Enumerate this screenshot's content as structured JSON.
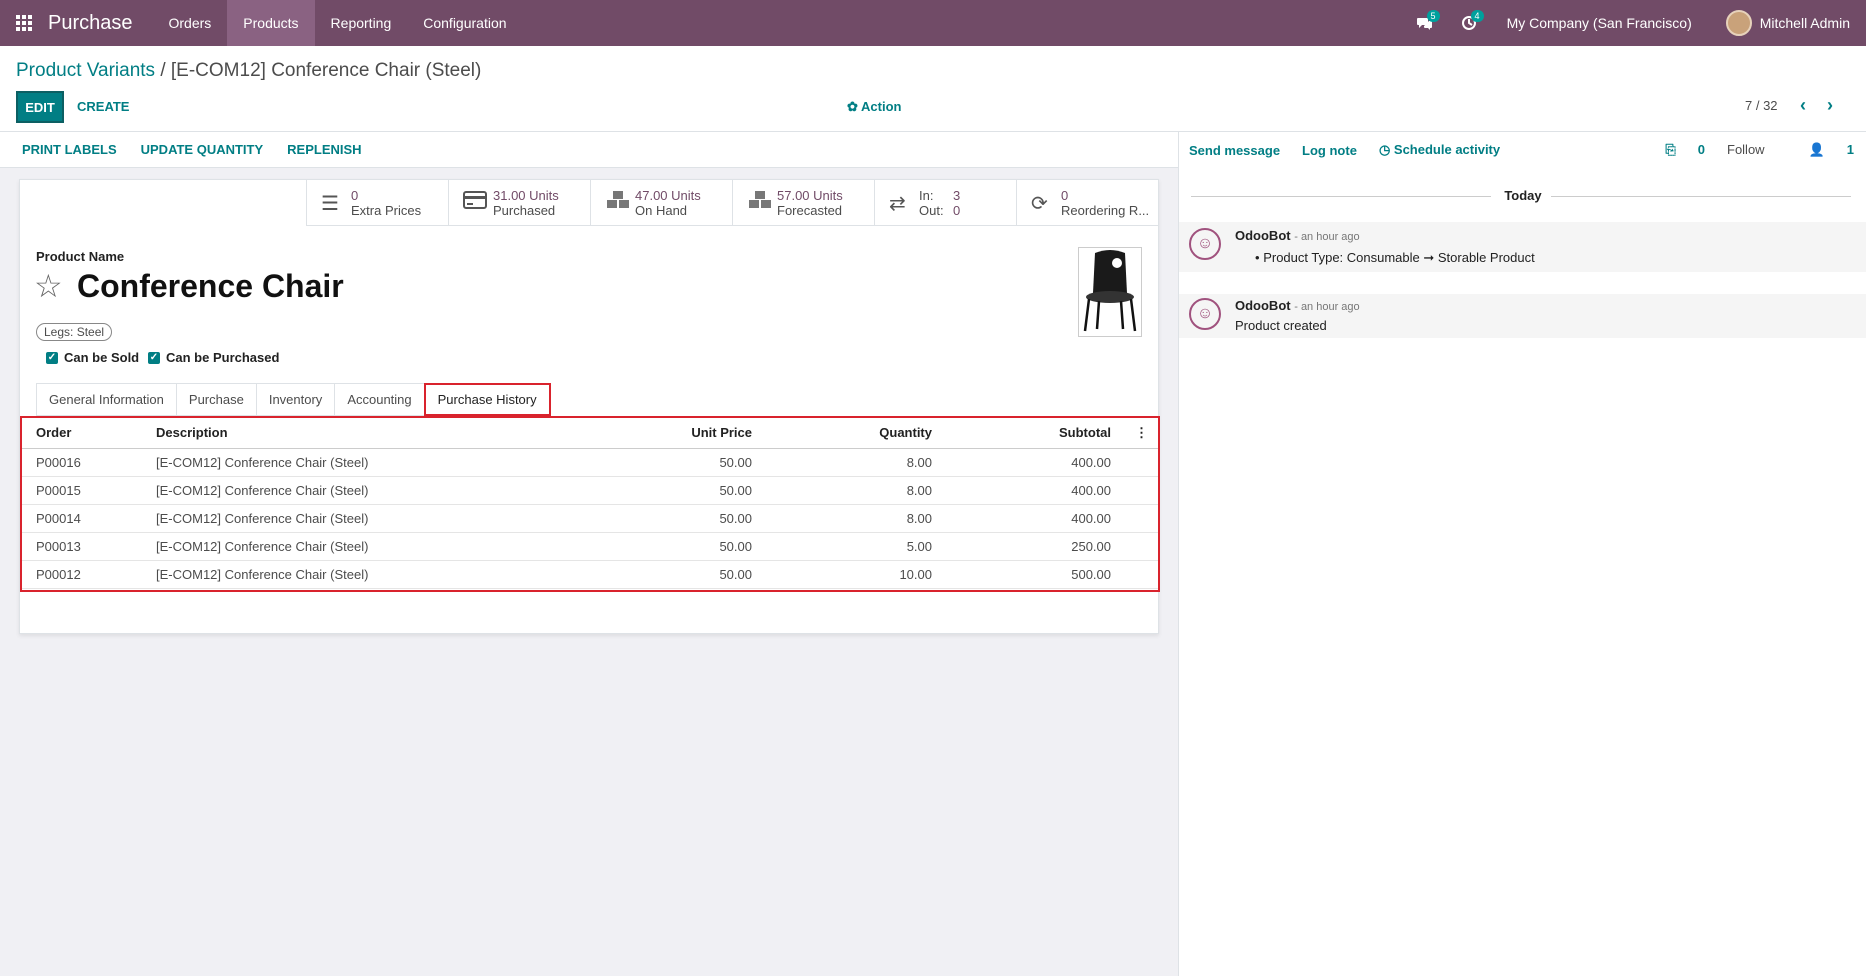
{
  "nav": {
    "app": "Purchase",
    "menus": [
      "Orders",
      "Products",
      "Reporting",
      "Configuration"
    ],
    "messages_badge": "5",
    "activities_badge": "4",
    "company": "My Company (San Francisco)",
    "user": "Mitchell Admin"
  },
  "control": {
    "breadcrumb_parent": "Product Variants",
    "breadcrumb_sep": "/",
    "breadcrumb_current": "[E-COM12] Conference Chair (Steel)",
    "edit": "EDIT",
    "create": "CREATE",
    "action": "Action",
    "pager": "7 / 32"
  },
  "statusbar": [
    "PRINT LABELS",
    "UPDATE QUANTITY",
    "REPLENISH"
  ],
  "smart_buttons": [
    {
      "icon": "list-icon",
      "value": "0",
      "label": "Extra Prices"
    },
    {
      "icon": "credit-card-icon",
      "value": "31.00 Units",
      "label": "Purchased"
    },
    {
      "icon": "cubes-icon",
      "value": "47.00 Units",
      "label": "On Hand"
    },
    {
      "icon": "cubes-icon",
      "value": "57.00 Units",
      "label": "Forecasted"
    },
    {
      "icon": "exchange-icon",
      "in_label": "In:",
      "in_value": "3",
      "out_label": "Out:",
      "out_value": "0"
    },
    {
      "icon": "refresh-icon",
      "value": "0",
      "label": "Reordering R..."
    }
  ],
  "product": {
    "name_label": "Product Name",
    "name": "Conference Chair",
    "tag": "Legs: Steel",
    "can_be_sold": "Can be Sold",
    "can_be_purchased": "Can be Purchased"
  },
  "tabs": [
    "General Information",
    "Purchase",
    "Inventory",
    "Accounting",
    "Purchase History"
  ],
  "table": {
    "headers": [
      "Order",
      "Description",
      "Unit Price",
      "Quantity",
      "Subtotal"
    ],
    "rows": [
      [
        "P00016",
        "[E-COM12] Conference Chair (Steel)",
        "50.00",
        "8.00",
        "400.00"
      ],
      [
        "P00015",
        "[E-COM12] Conference Chair (Steel)",
        "50.00",
        "8.00",
        "400.00"
      ],
      [
        "P00014",
        "[E-COM12] Conference Chair (Steel)",
        "50.00",
        "8.00",
        "400.00"
      ],
      [
        "P00013",
        "[E-COM12] Conference Chair (Steel)",
        "50.00",
        "5.00",
        "250.00"
      ],
      [
        "P00012",
        "[E-COM12] Conference Chair (Steel)",
        "50.00",
        "10.00",
        "500.00"
      ]
    ]
  },
  "chatter": {
    "send_message": "Send message",
    "log_note": "Log note",
    "schedule_activity": "Schedule activity",
    "attachments": "0",
    "follow": "Follow",
    "followers": "1",
    "today": "Today",
    "messages": [
      {
        "author": "OdooBot",
        "time": "- an hour ago",
        "body": "Product Type: Consumable ➞ Storable Product"
      },
      {
        "author": "OdooBot",
        "time": "- an hour ago",
        "body": "Product created"
      }
    ]
  }
}
